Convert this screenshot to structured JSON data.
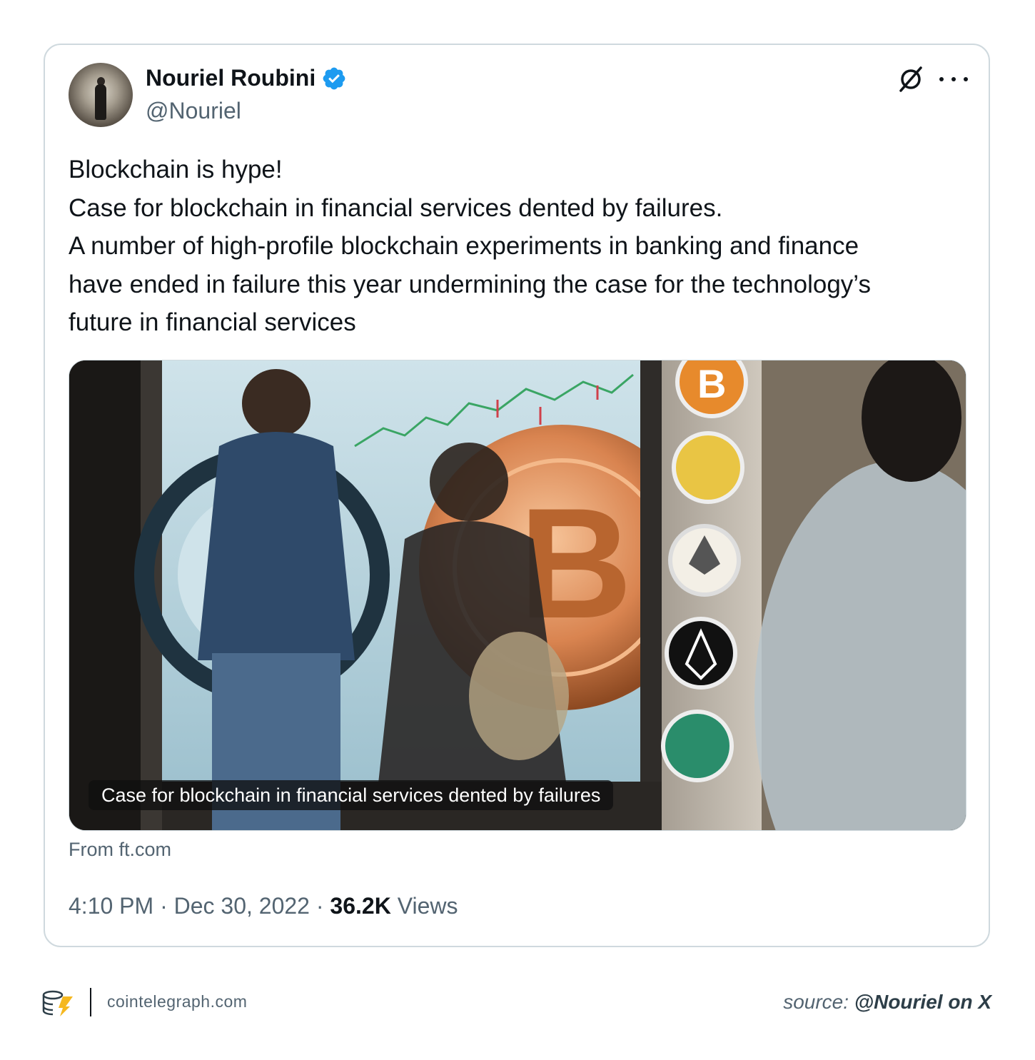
{
  "tweet": {
    "author_name": "Nouriel Roubini",
    "author_handle": "@Nouriel",
    "text_lines": [
      "Blockchain is hype!",
      "Case for blockchain in financial services dented by failures.",
      "A number of high-profile blockchain experiments in banking and finance",
      "have ended in failure this year undermining the case for the technology’s",
      "future in financial services"
    ],
    "media_caption": "Case for blockchain in financial services dented by failures",
    "link_source": "From ft.com",
    "time": "4:10 PM",
    "date": "Dec 30, 2022",
    "views_count": "36.2K",
    "views_label": "Views",
    "separator": "·",
    "icons": [
      "verified-badge-icon",
      "grok-icon",
      "more-icon"
    ],
    "colors": {
      "verified": "#1d9bf0",
      "secondary_text": "#536471",
      "border": "#cfd9de"
    }
  },
  "footer": {
    "site": "cointelegraph.com",
    "source_label": "source:",
    "source_value": "@Nouriel on X"
  }
}
